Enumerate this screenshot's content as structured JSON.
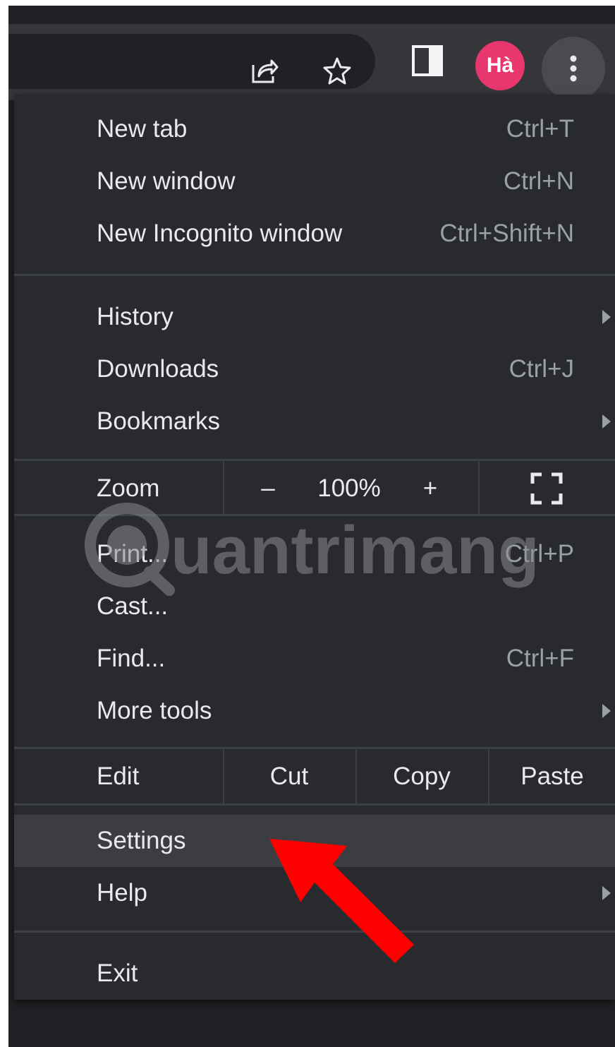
{
  "toolbar": {
    "share_icon": "share-icon",
    "bookmark_icon": "star-icon",
    "side_panel_icon": "side-panel-icon",
    "profile_initials": "Hà",
    "menu_icon": "kebab-menu-icon",
    "avatar_color": "#e8366e"
  },
  "menu": {
    "new_tab": {
      "label": "New tab",
      "shortcut": "Ctrl+T"
    },
    "new_window": {
      "label": "New window",
      "shortcut": "Ctrl+N"
    },
    "new_incognito": {
      "label": "New Incognito window",
      "shortcut": "Ctrl+Shift+N"
    },
    "history": {
      "label": "History"
    },
    "downloads": {
      "label": "Downloads",
      "shortcut": "Ctrl+J"
    },
    "bookmarks": {
      "label": "Bookmarks"
    },
    "zoom": {
      "label": "Zoom",
      "minus": "–",
      "value": "100%",
      "plus": "+",
      "fullscreen_icon": "fullscreen-icon"
    },
    "print": {
      "label": "Print...",
      "shortcut": "Ctrl+P"
    },
    "cast": {
      "label": "Cast..."
    },
    "find": {
      "label": "Find...",
      "shortcut": "Ctrl+F"
    },
    "more_tools": {
      "label": "More tools"
    },
    "edit": {
      "label": "Edit",
      "cut": "Cut",
      "copy": "Copy",
      "paste": "Paste"
    },
    "settings": {
      "label": "Settings"
    },
    "help": {
      "label": "Help"
    },
    "exit": {
      "label": "Exit"
    }
  },
  "watermark": {
    "text": "uantrimang"
  },
  "annotation": {
    "arrow_color": "#ff0000",
    "icon": "red-arrow-annotation"
  }
}
